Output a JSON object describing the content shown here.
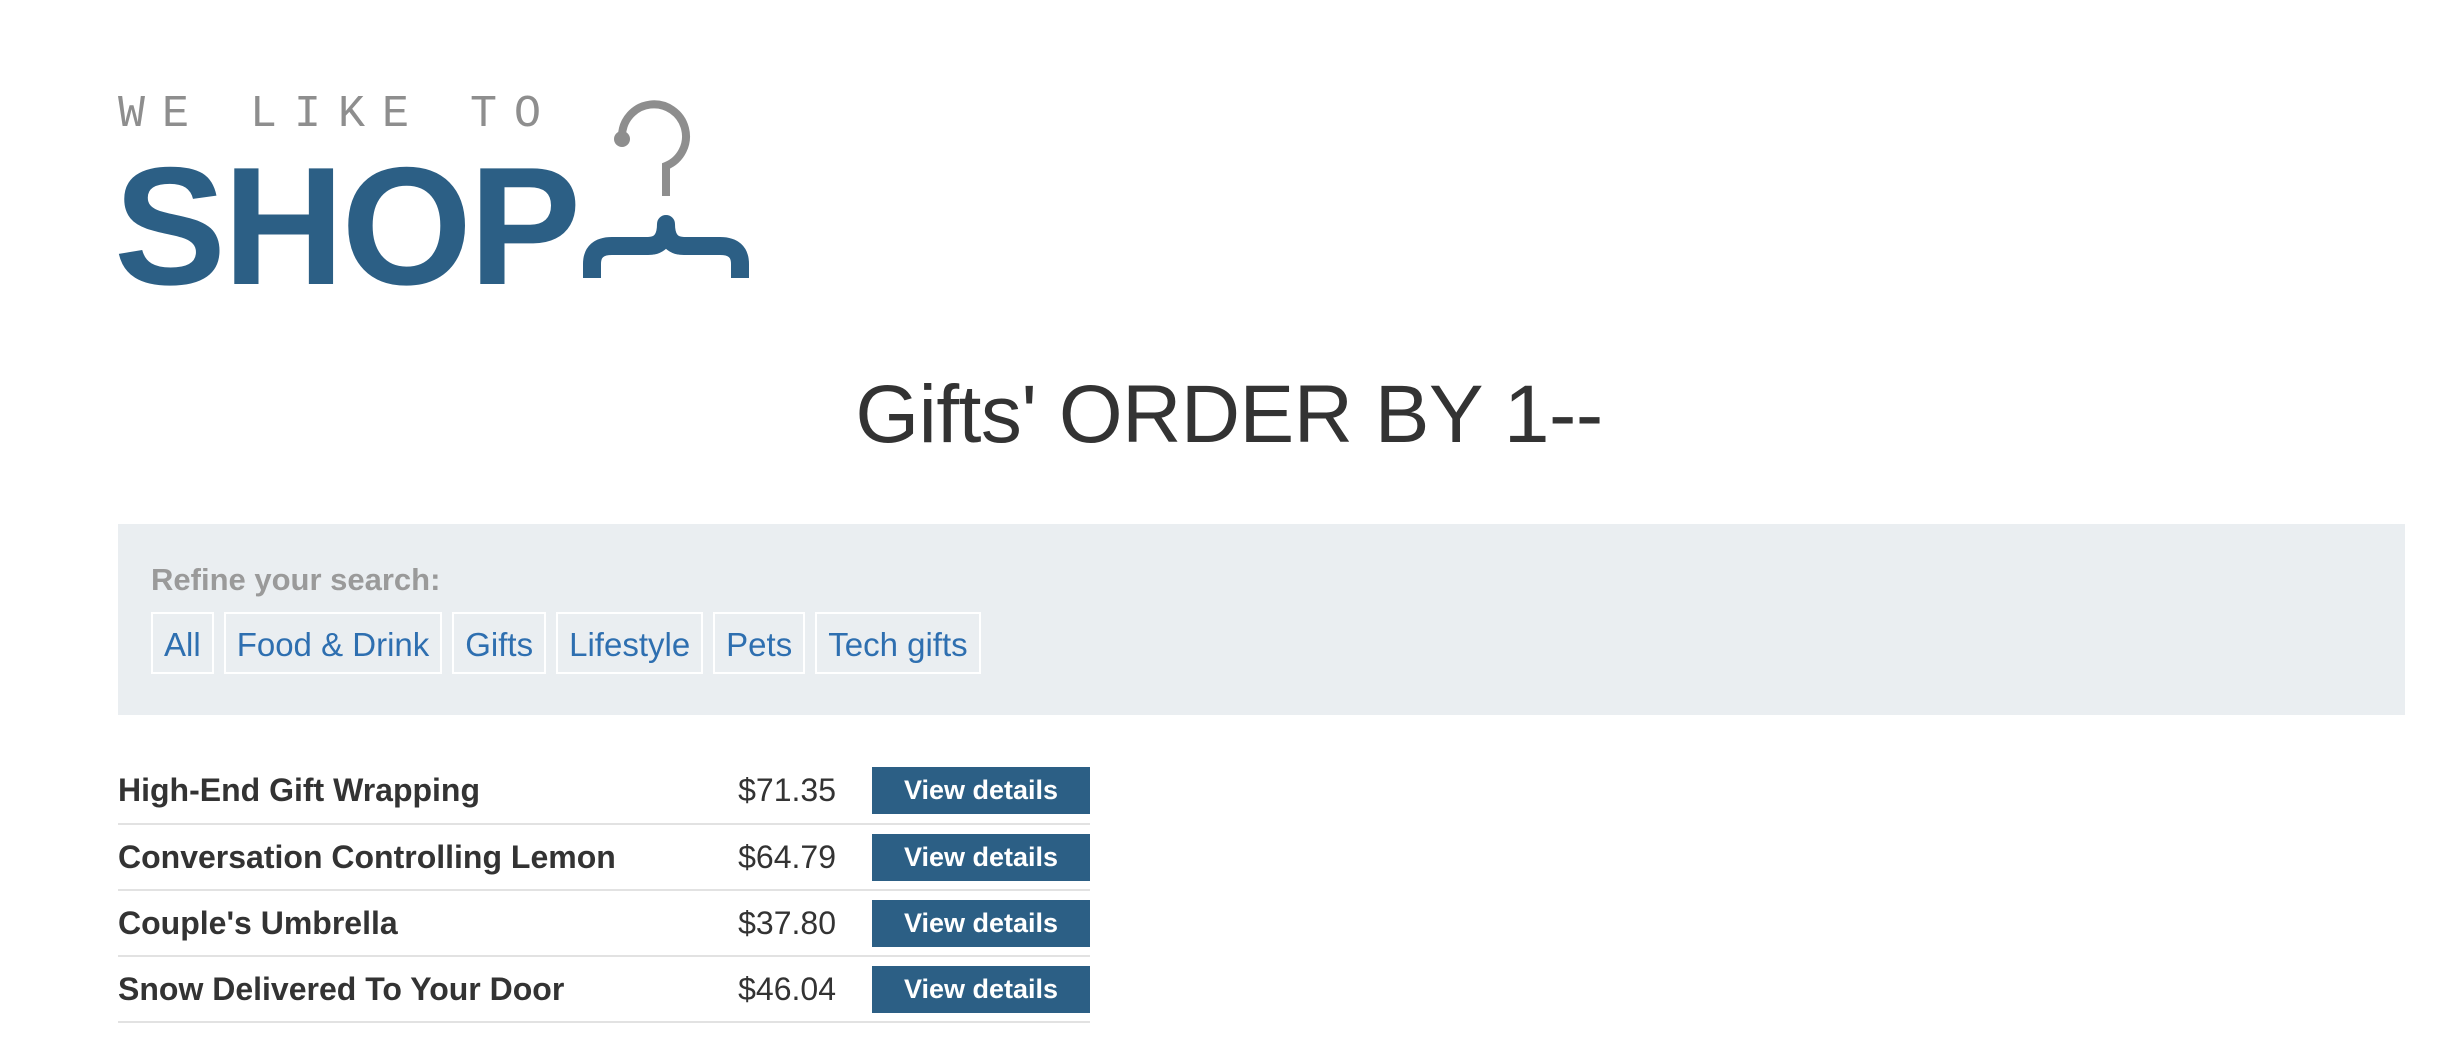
{
  "logo": {
    "tagline": "WE LIKE TO",
    "word": "SHOP",
    "icon": "hanger-icon",
    "colors": {
      "primary": "#2c5f85",
      "secondary": "#8e8e8e"
    }
  },
  "page_title": "Gifts' ORDER BY 1--",
  "filters": {
    "label": "Refine your search:",
    "items": [
      {
        "label": "All"
      },
      {
        "label": "Food & Drink"
      },
      {
        "label": "Gifts"
      },
      {
        "label": "Lifestyle"
      },
      {
        "label": "Pets"
      },
      {
        "label": "Tech gifts"
      }
    ]
  },
  "products": [
    {
      "name": "High-End Gift Wrapping",
      "price": "$71.35",
      "button": "View details"
    },
    {
      "name": "Conversation Controlling Lemon",
      "price": "$64.79",
      "button": "View details"
    },
    {
      "name": "Couple's Umbrella",
      "price": "$37.80",
      "button": "View details"
    },
    {
      "name": "Snow Delivered To Your Door",
      "price": "$46.04",
      "button": "View details"
    }
  ],
  "colors": {
    "accent": "#2c5f85",
    "link": "#2e6fb0",
    "panel_background": "#eaeef1"
  }
}
